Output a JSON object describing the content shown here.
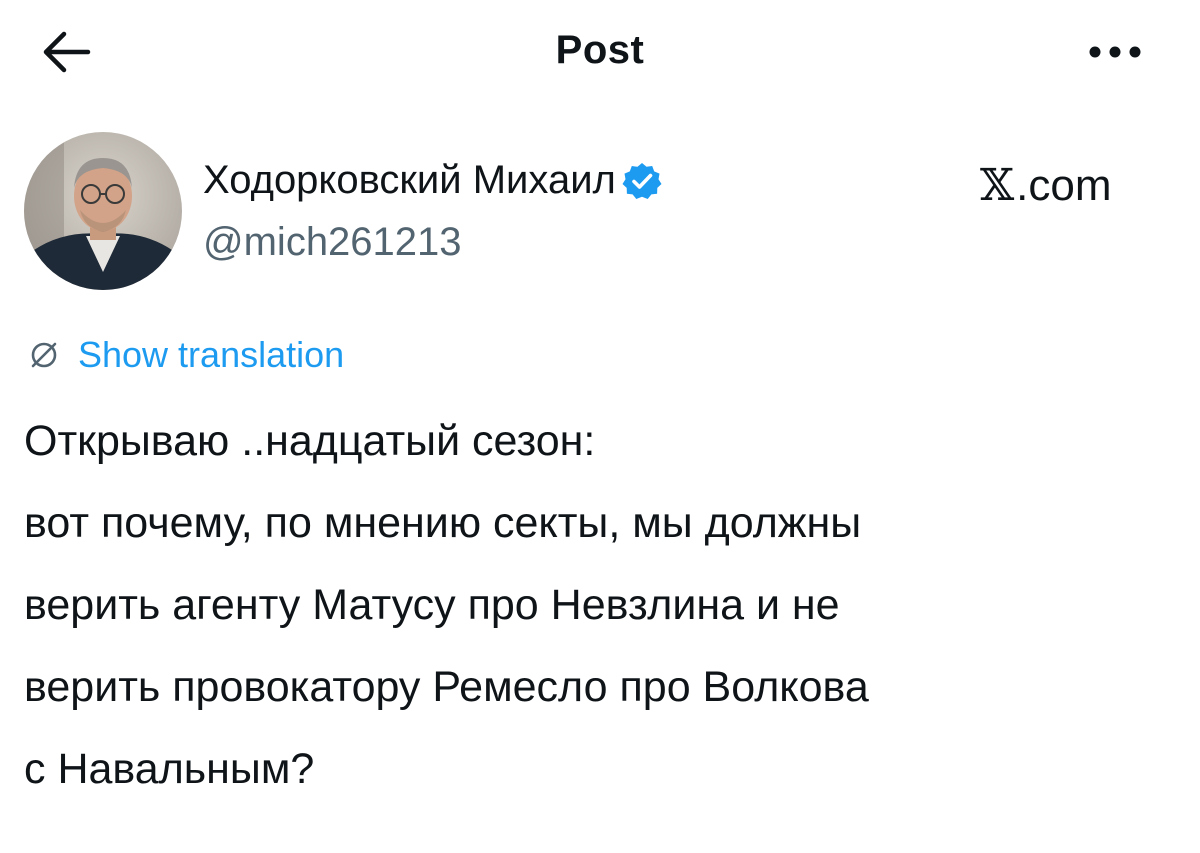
{
  "header": {
    "title": "Post",
    "back_icon": "arrow-left-icon",
    "more_icon": "ellipsis-icon"
  },
  "author": {
    "name": "Ходорковский Михаил",
    "handle": "@mich261213",
    "verified": true,
    "verified_color": "#1d9bf0",
    "avatar_icon": "profile-photo"
  },
  "brand": {
    "x_glyph": "𝕏",
    "suffix": ".com"
  },
  "translation": {
    "label": "Show translation",
    "icon": "globe-icon",
    "color": "#1d9bf0"
  },
  "tweet": {
    "lines": [
      "Открываю ..надцатый сезон:",
      "вот почему, по мнению секты, мы должны",
      "верить агенту Матусу про Невзлина и не",
      "верить провокатору Ремесло про Волкова",
      "с Навальным?"
    ]
  }
}
